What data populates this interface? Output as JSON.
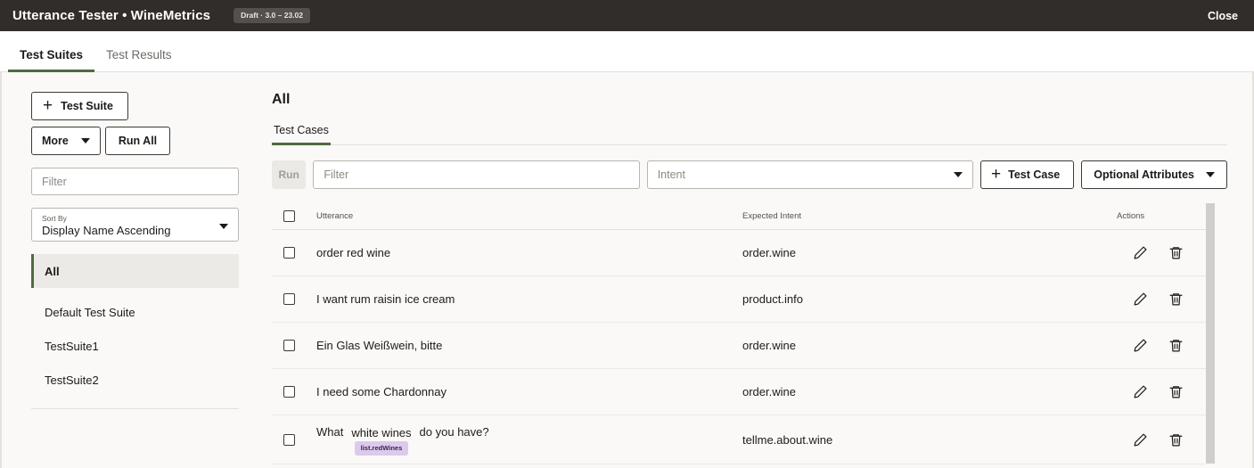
{
  "topbar": {
    "title": "Utterance Tester • WineMetrics",
    "badge": "Draft · 3.0 – 23.02",
    "close_label": "Close"
  },
  "tabs": [
    {
      "label": "Test Suites",
      "active": true
    },
    {
      "label": "Test Results",
      "active": false
    }
  ],
  "sidebar": {
    "add_suite_label": "Test Suite",
    "add_suite_icon": "plus-icon",
    "more_label": "More",
    "more_icon": "chevron-down-icon",
    "run_all_label": "Run All",
    "filter_placeholder": "Filter",
    "sort_by_label": "Sort By",
    "sort_by_value": "Display Name Ascending",
    "sort_icon": "chevron-down-icon",
    "suites": [
      {
        "label": "All",
        "selected": true
      },
      {
        "label": "Default Test Suite",
        "selected": false
      },
      {
        "label": "TestSuite1",
        "selected": false
      },
      {
        "label": "TestSuite2",
        "selected": false
      }
    ]
  },
  "main": {
    "title": "All",
    "subtabs": [
      {
        "label": "Test Cases",
        "active": true
      }
    ],
    "toolbar": {
      "run_label": "Run",
      "run_disabled": true,
      "filter_placeholder": "Filter",
      "intent_placeholder": "Intent",
      "intent_icon": "chevron-down-icon",
      "add_testcase_label": "Test Case",
      "add_testcase_icon": "plus-icon",
      "optional_attributes_label": "Optional Attributes",
      "optional_attributes_icon": "chevron-down-icon"
    },
    "table": {
      "columns": [
        "Utterance",
        "Expected Intent",
        "Actions"
      ],
      "select_all_checked": false,
      "edit_icon": "pencil-icon",
      "delete_icon": "trash-icon",
      "rows": [
        {
          "checked": false,
          "utterance": "order red wine",
          "expected_intent": "order.wine",
          "annotation": null
        },
        {
          "checked": false,
          "utterance": "I want rum raisin ice cream",
          "expected_intent": "product.info",
          "annotation": null
        },
        {
          "checked": false,
          "utterance": "Ein Glas Weißwein, bitte",
          "expected_intent": "order.wine",
          "annotation": null
        },
        {
          "checked": false,
          "utterance": "I need some Chardonnay",
          "expected_intent": "order.wine",
          "annotation": null
        },
        {
          "checked": false,
          "utterance_before": "What",
          "utterance_entity": "white wines",
          "entity_tag": "list.redWines",
          "utterance_after": "do you have?",
          "expected_intent": "tellme.about.wine",
          "annotation": true
        }
      ]
    }
  },
  "colors": {
    "header_bg": "#312d2a",
    "accent_green": "#4e6b3f",
    "page_bg": "#faf9f7",
    "entity_tag_bg": "#ddc9ee"
  }
}
